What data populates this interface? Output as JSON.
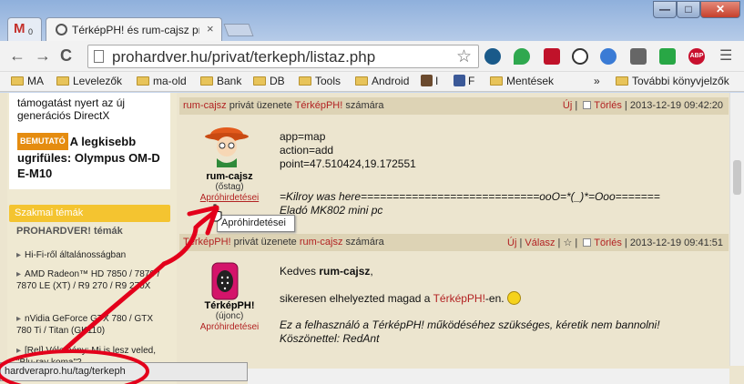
{
  "tabs": [
    {
      "title": "",
      "badge": "0"
    },
    {
      "title": "TérképPH! és rum-cajsz privát üzenete",
      "close": "×"
    }
  ],
  "window": {
    "min": "—",
    "max": "□",
    "close": "✕"
  },
  "toolbar": {
    "back": "←",
    "forward": "→",
    "reload": "C",
    "url": "prohardver.hu/privat/terkeph/listaz.php",
    "star": "☆",
    "abp": "ABP"
  },
  "bookmarks": {
    "items": [
      "MA",
      "Levelezők",
      "ma-old",
      "Bank",
      "DB",
      "Tools",
      "Android",
      "I",
      "F",
      "Mentések"
    ],
    "more": "»",
    "other": "További könyvjelzők"
  },
  "sidebar": {
    "promo_top": "támogatást nyert az új generációs DirectX",
    "badge": "BEMUTATÓ",
    "promo_title": "A legkisebb ugrifüles: Olympus OM-D E-M10",
    "section": "Szakmai témák",
    "subsection": "PROHARDVER! témák",
    "links": [
      "Hi-Fi-ről általánosságban",
      "AMD Radeon™ HD 7850 / 7870 / 7870 LE (XT) / R9 270 / R9 270X",
      "nVidia GeForce GTX 780 / GTX 780 Ti / Titan (GK110)",
      "[Rel] Vélemény: Mi is lesz veled, \"Blu-ray koma\"?"
    ]
  },
  "messages": [
    {
      "from": "rum-cajsz",
      "mid": "privát üzenete",
      "to": "TérképPH!",
      "end": "számára",
      "action_new": "Új",
      "action_delete": "Törlés",
      "date": "2013-12-19 09:42:20",
      "user_name": "rum-cajsz",
      "user_rank": "(őstag)",
      "user_link": "Apróhirdetései",
      "lines": [
        "app=map",
        "action=add",
        "point=47.510424,19.172551"
      ],
      "sig": "=Kilroy was here============================ooO=*(_)*=Ooo=======",
      "sig2": "Eladó MK802 mini pc"
    },
    {
      "from": "TérképPH!",
      "mid": "privát üzenete",
      "to": "rum-cajsz",
      "end": "számára",
      "action_new": "Új",
      "action_reply": "Válasz",
      "action_delete": "Törlés",
      "date": "2013-12-19 09:41:51",
      "user_name": "TérképPH!",
      "user_rank": "(újonc)",
      "user_link": "Apróhirdetései",
      "greet_pre": "Kedves",
      "greet_name": "rum-cajsz",
      "success_pre": "sikeresen elhelyezted magad a",
      "success_link": "TérképPH!",
      "success_post": "-en.",
      "note": "Ez a felhasználó a TérképPH! működéséhez szükséges, kéretik nem bannolni!",
      "thanks": "Köszönettel: RedAnt"
    }
  ],
  "tooltip": "Apróhirdetései",
  "status_url": "hardverapro.hu/tag/terkeph",
  "colors": {
    "accent_red": "#b22222",
    "annotation": "#e3001b",
    "section_yellow": "#f4c430"
  }
}
